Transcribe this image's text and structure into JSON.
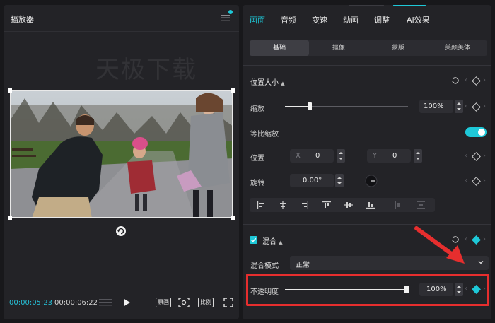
{
  "player": {
    "title": "播放器",
    "watermark": "天极下载",
    "time_current": "00:00:05:23",
    "time_total": "00:00:06:22",
    "btn_original": "原画",
    "btn_ratio": "比例"
  },
  "panel": {
    "tabs": [
      "画面",
      "音频",
      "变速",
      "动画",
      "调整",
      "AI效果"
    ],
    "active_tab": "画面",
    "subtabs": [
      "基础",
      "抠像",
      "蒙版",
      "美颜美体"
    ],
    "active_subtab": "基础",
    "position_size": {
      "title": "位置大小",
      "scale_label": "缩放",
      "scale_value": "100%",
      "scale_fraction": 0.2,
      "uniform_label": "等比缩放",
      "position_label": "位置",
      "x_label": "X",
      "x_value": "0",
      "y_label": "Y",
      "y_value": "0",
      "rotate_label": "旋转",
      "rotate_value": "0.00°"
    },
    "blend": {
      "title": "混合",
      "mode_label": "混合模式",
      "mode_value": "正常",
      "opacity_label": "不透明度",
      "opacity_value": "100%",
      "opacity_fraction": 1.0
    }
  },
  "colors": {
    "accent": "#1ec8d8",
    "highlight": "#e62e2e"
  }
}
